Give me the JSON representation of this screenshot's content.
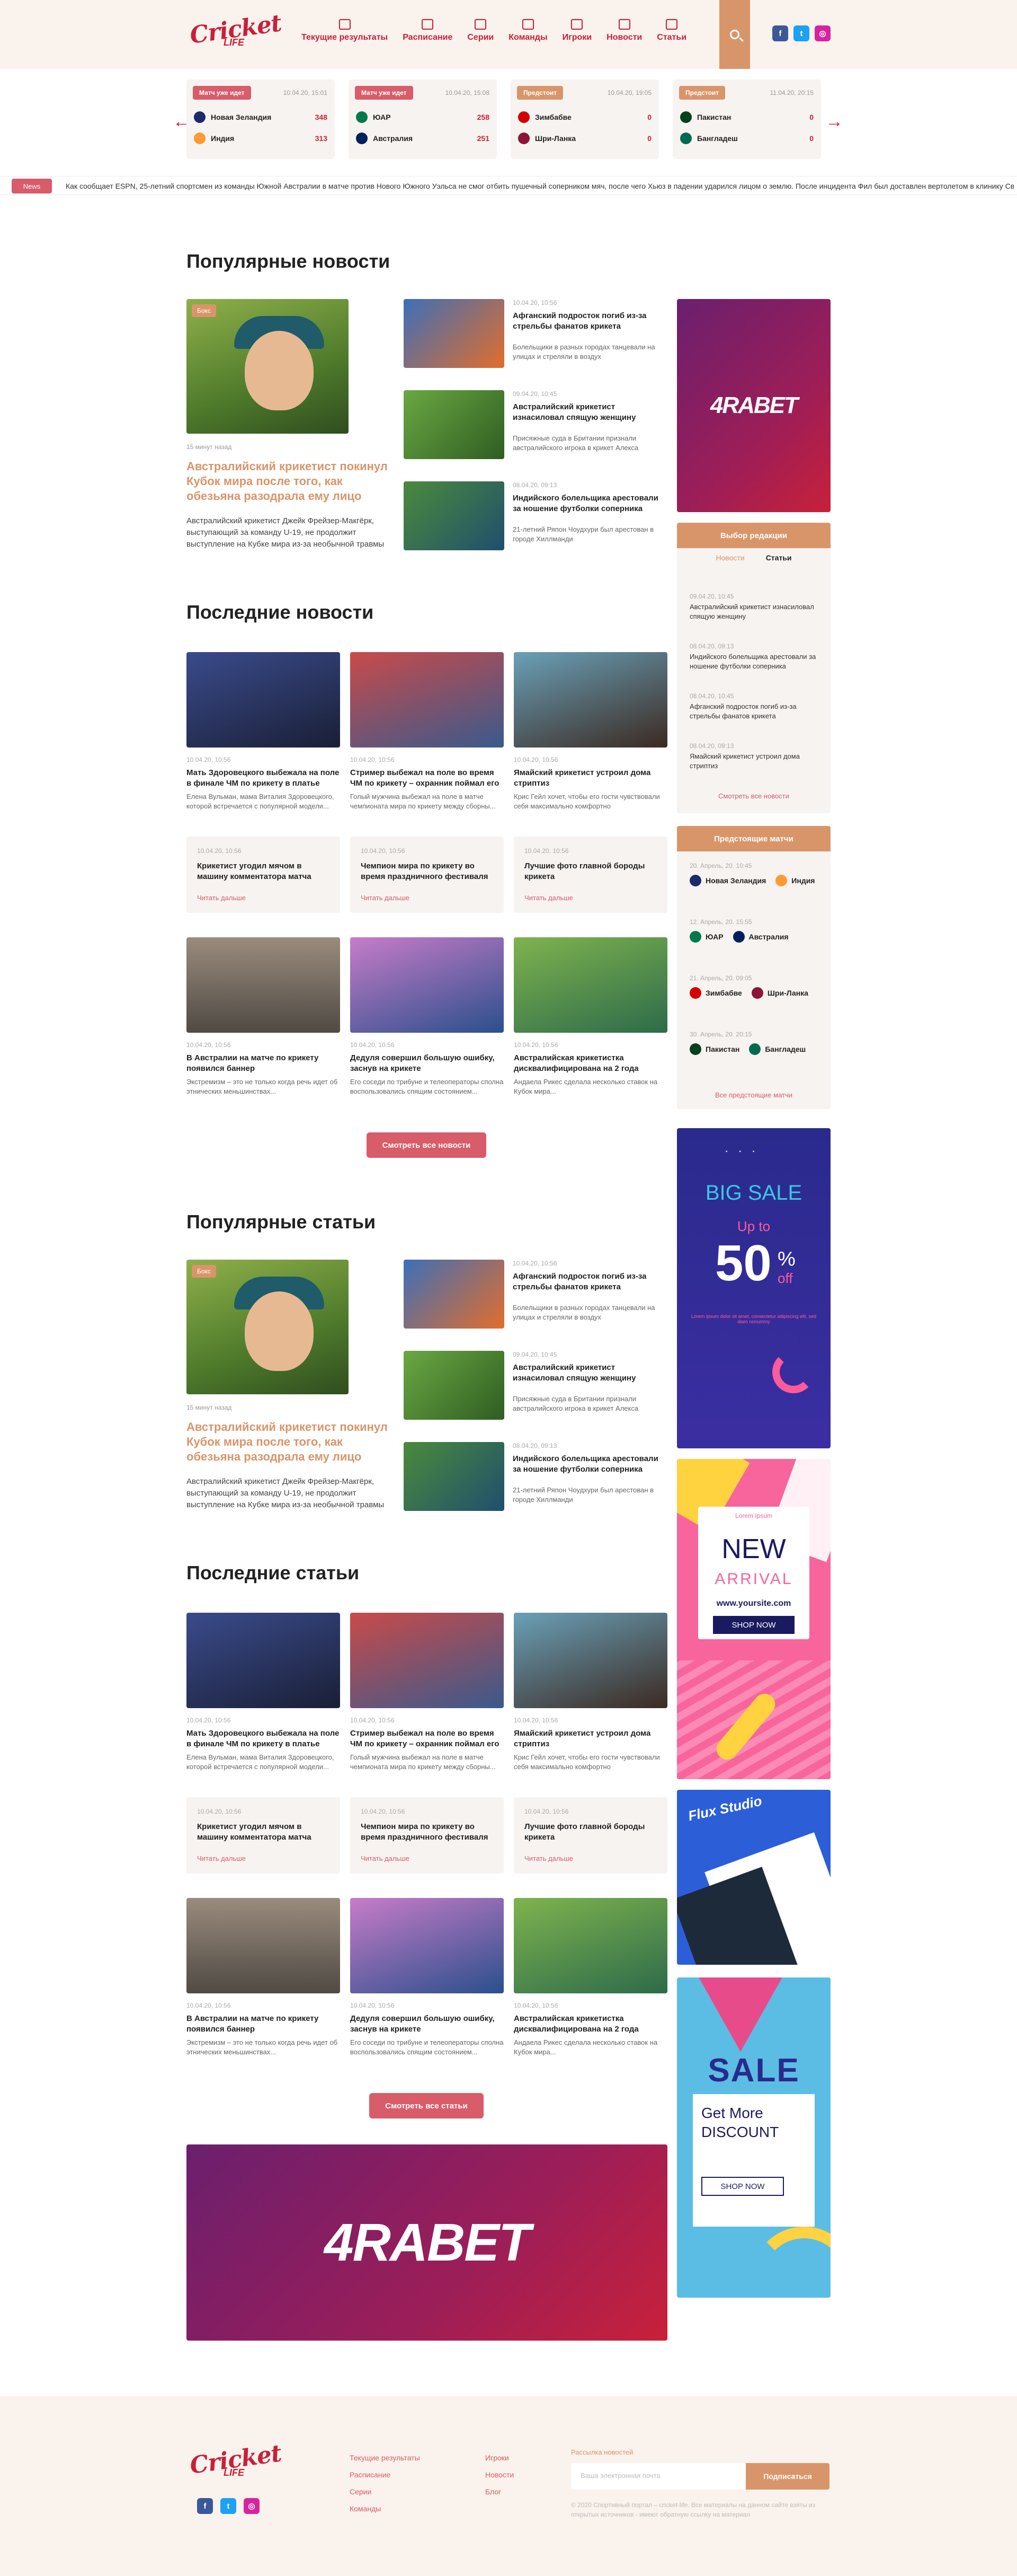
{
  "header": {
    "logo_text": "Cricket",
    "logo_sub": "LIFE",
    "nav": [
      {
        "label": "Текущие результаты",
        "icon": "scoreboard-icon"
      },
      {
        "label": "Расписание",
        "icon": "calendar-icon"
      },
      {
        "label": "Серии",
        "icon": "series-icon"
      },
      {
        "label": "Команды",
        "icon": "team-icon"
      },
      {
        "label": "Игроки",
        "icon": "players-icon"
      },
      {
        "label": "Новости",
        "icon": "news-icon"
      },
      {
        "label": "Статьи",
        "icon": "pen-icon"
      }
    ],
    "social": [
      {
        "label": "f",
        "color": "#3b5998"
      },
      {
        "label": "t",
        "color": "#1da1f2"
      },
      {
        "label": "◎",
        "color": "#d6249f"
      }
    ]
  },
  "matches": [
    {
      "status": "Матч уже идет",
      "status_color": "#d85c6a",
      "date": "10.04.20, 15:01",
      "team1": "Новая Зеландия",
      "score1": "348",
      "team2": "Индия",
      "score2": "313",
      "f1": "#1b2a6b",
      "f2": "#ff9933"
    },
    {
      "status": "Матч уже идет",
      "status_color": "#d85c6a",
      "date": "10.04.20, 15:08",
      "team1": "ЮАР",
      "score1": "258",
      "team2": "Австралия",
      "score2": "251",
      "f1": "#007a4d",
      "f2": "#00205b"
    },
    {
      "status": "Предстоит",
      "status_color": "#d9956a",
      "date": "10.04.20, 19:05",
      "team1": "Зимбабве",
      "score1": "0",
      "team2": "Шри-Ланка",
      "score2": "0",
      "f1": "#d40000",
      "f2": "#8d153a"
    },
    {
      "status": "Предстоит",
      "status_color": "#d9956a",
      "date": "11.04.20, 20:15",
      "team1": "Пакистан",
      "score1": "0",
      "team2": "Бангладеш",
      "score2": "0",
      "f1": "#01411c",
      "f2": "#006a4e"
    }
  ],
  "ticker": {
    "badge": "News",
    "text": "Как сообщает ESPN, 25-летний спортсмен из команды Южной Австралии в матче против Нового Южного Уэльса не смог отбить пушечный соперником мяч, после чего Хьюз в падении ударился лицом о землю. После инцидента Фил был доставлен вертолетом в клинику Святого Винсента в С"
  },
  "popular_news": {
    "title": "Популярные новости",
    "badge": "Бокс",
    "meta": "15 минут назад",
    "big_title": "Австралийский крикетист покинул Кубок мира после того, как обезьяна разодрала ему лицо",
    "big_desc": "Австралийский крикетист Джейк Фрейзер-Макгёрк, выступающий за команду U-19, не продолжит выступление на Кубке мира из-за необычной травмы",
    "items": [
      {
        "date": "10.04.20, 10:56",
        "title": "Афганский подросток погиб из-за стрельбы фанатов крикета",
        "desc": "Болельщики в разных городах танцевали на улицах и стреляли в воздух"
      },
      {
        "date": "09.04.20, 10:45",
        "title": "Австралийский крикетист изнасиловал спящую женщину",
        "desc": "Присяжные суда в Британии признали австралийского игрока в крикет Алекса"
      },
      {
        "date": "08.04.20, 09:13",
        "title": "Индийского болельщика арестовали за ношение футболки соперника",
        "desc": "21-летний Ряпон Чоудхури был арестован в городе Хиллманди"
      }
    ]
  },
  "latest_news": {
    "title": "Последние новости",
    "cards": [
      {
        "date": "10.04.20, 10:56",
        "title": "Мать Здоровецкого выбежала на поле в финале ЧМ по крикету в платье",
        "desc": "Елена Вульман, мама Виталия Здоровецкого, которой встречается с популярной модели..."
      },
      {
        "date": "10.04.20, 10:56",
        "title": "Стример выбежал на поле во время ЧМ по крикету – охранник поймал его",
        "desc": "Голый мужчина выбежал на поле в матче чемпионата мира по крикету между сборны..."
      },
      {
        "date": "10.04.20, 10:56",
        "title": "Ямайский крикетист устроил дома стриптиз",
        "desc": "Крис Гейл хочет, чтобы его гости чувствовали себя максимально комфортно"
      }
    ],
    "tcards": [
      {
        "date": "10.04.20, 10:56",
        "title": "Крикетист угодил мячом в машину комментатора матча",
        "link": "Читать дальше"
      },
      {
        "date": "10.04.20, 10:56",
        "title": "Чемпион мира по крикету во время праздничного фестиваля",
        "link": "Читать дальше"
      },
      {
        "date": "10.04.20, 10:56",
        "title": "Лучшие фото главной бороды крикета",
        "link": "Читать дальше"
      }
    ],
    "cards2": [
      {
        "date": "10.04.20, 10:56",
        "title": "В Австралии на матче по крикету появился баннер",
        "desc": "Экстремизм – это не только когда речь идет об этнических меньшинствах..."
      },
      {
        "date": "10.04.20, 10:56",
        "title": "Дедуля совершил большую ошибку, заснув на крикете",
        "desc": "Его соседи по трибуне и телеоператоры сполна воспользовались спящим состоянием..."
      },
      {
        "date": "10.04.20, 10:56",
        "title": "Австралийская крикетистка дисквалифицирована на 2 года",
        "desc": "Андаела Рикес сделала несколько ставок на Кубок мира..."
      }
    ],
    "button": "Смотреть все новости"
  },
  "popular_articles": {
    "title": "Популярные статьи"
  },
  "latest_articles": {
    "title": "Последние статьи",
    "button": "Смотреть все статьи"
  },
  "sidebar": {
    "ad_brand": "4RABET",
    "editor": {
      "title": "Выбор редакции",
      "tab1": "Новости",
      "tab2": "Статьи",
      "items": [
        {
          "date": "09.04.20, 10:45",
          "title": "Австралийский крикетист изнасиловал спящую женщину"
        },
        {
          "date": "08.04.20, 09:13",
          "title": "Индийского болельщика арестовали за ношение футболки соперника"
        },
        {
          "date": "08.04.20, 10:45",
          "title": "Афганский подросток погиб из-за стрельбы фанатов крикета"
        },
        {
          "date": "08.04.20, 09:13",
          "title": "Ямайский крикетист устроил дома стриптиз"
        }
      ],
      "link": "Смотреть все новости"
    },
    "upcoming": {
      "title": "Предстоящие матчи",
      "items": [
        {
          "date": "20. Апрель, 20. 10:45",
          "t1": "Новая Зеландия",
          "t2": "Индия",
          "f1": "#1b2a6b",
          "f2": "#ff9933"
        },
        {
          "date": "12. Апрель, 20. 15:55",
          "t1": "ЮАР",
          "t2": "Австралия",
          "f1": "#007a4d",
          "f2": "#00205b"
        },
        {
          "date": "21. Апрель, 20. 09:05",
          "t1": "Зимбабве",
          "t2": "Шри-Ланка",
          "f1": "#d40000",
          "f2": "#8d153a"
        },
        {
          "date": "30. Апрель, 20. 20:15",
          "t1": "Пакистан",
          "t2": "Бангладеш",
          "f1": "#01411c",
          "f2": "#006a4e"
        }
      ],
      "link": "Все предстоящие матчи"
    },
    "ad_sale": {
      "big": "BIG SALE",
      "upto": "Up to",
      "pct": "50",
      "off": "off",
      "small": "Lorem ipsum dolor sit amet, consectetur adipiscing elit, sed diam nonummy"
    },
    "ad_new": {
      "lorem": "Lorem Ipsum",
      "new": "NEW",
      "arrival": "ARRIVAL",
      "site": "www.yoursite.com",
      "shop": "SHOP NOW"
    },
    "ad_flux": {
      "name": "Flux Studio"
    },
    "ad_sale2": {
      "sale": "SALE",
      "get": "Get More",
      "discount": "DISCOUNT",
      "shop": "SHOP NOW"
    }
  },
  "footer": {
    "col1": [
      "Текущие результаты",
      "Расписание",
      "Серии",
      "Команды"
    ],
    "col2": [
      "Игроки",
      "Новости",
      "Блог"
    ],
    "newsletter_label": "Рассылка новостей",
    "input_placeholder": "Ваша электронная почта",
    "subscribe": "Подписаться",
    "copyright": "© 2020 Спортивный портал – cricket-life. Все материалы на данном сайте взяты из открытых источников - имеют обратную ссылку на материал"
  }
}
